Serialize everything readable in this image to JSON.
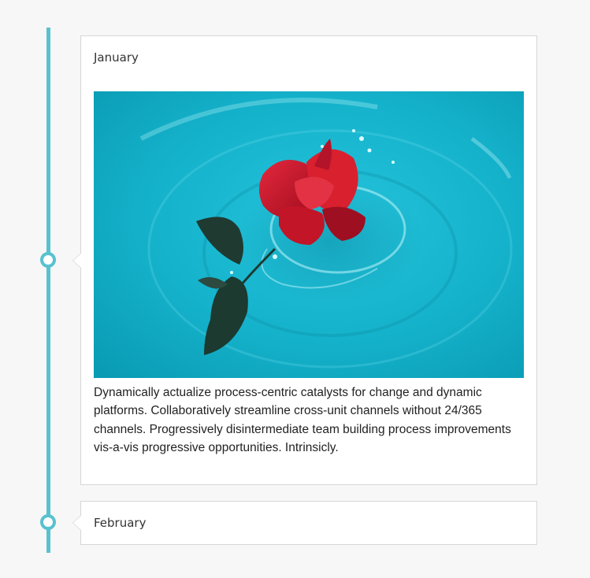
{
  "timeline": {
    "accent_color": "#58c1cf",
    "entries": [
      {
        "month": "January",
        "image_subject": "red-rose-splashing-in-turquoise-water",
        "description": "Dynamically actualize process-centric catalysts for change and dynamic platforms. Collaboratively streamline cross-unit channels without 24/365 channels. Progressively disintermediate team building process improvements vis-a-vis progressive opportunities. Intrinsicly."
      },
      {
        "month": "February"
      }
    ]
  }
}
